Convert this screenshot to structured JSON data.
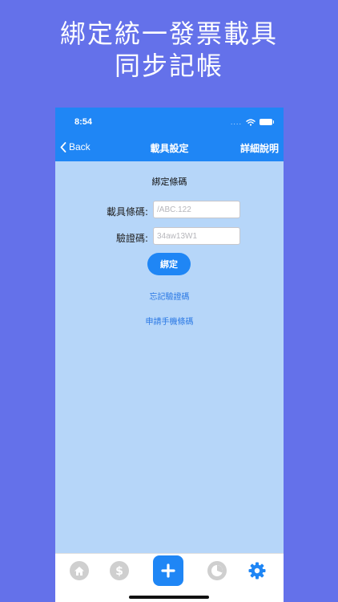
{
  "promo": {
    "line1": "綁定統一發票載具",
    "line2": "同步記帳"
  },
  "status_bar": {
    "time": "8:54",
    "signal_dots": "....",
    "icons": [
      "wifi-icon",
      "battery-icon"
    ]
  },
  "nav": {
    "back_label": "Back",
    "title": "載具設定",
    "right_label": "詳細說明"
  },
  "form": {
    "section_title": "綁定條碼",
    "barcode_label": "載具條碼:",
    "barcode_placeholder": "/ABC.122",
    "verify_label": "驗證碼:",
    "verify_placeholder": "34aw13W1",
    "bind_button": "綁定"
  },
  "links": {
    "forgot_code": "忘記驗證碼",
    "apply_barcode": "申請手機條碼"
  },
  "tabbar": {
    "items": [
      "home-icon",
      "dollar-icon",
      "add-icon",
      "pie-chart-icon",
      "gear-icon"
    ],
    "active": "gear-icon"
  },
  "colors": {
    "background": "#6471EA",
    "accent": "#1F86F5",
    "content_bg": "#B6D6F9",
    "link": "#2A78E4"
  }
}
